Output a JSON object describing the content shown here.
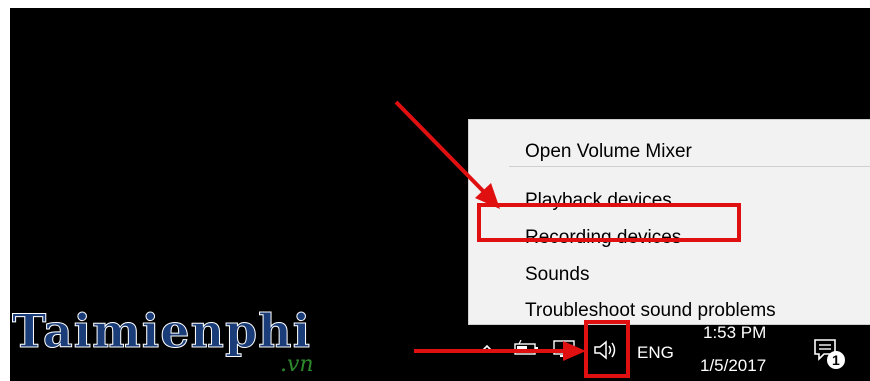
{
  "menu": {
    "items": [
      {
        "label": "Open Volume Mixer"
      },
      {
        "label": "Playback devices"
      },
      {
        "label": "Recording devices"
      },
      {
        "label": "Sounds"
      },
      {
        "label": "Troubleshoot sound problems"
      }
    ]
  },
  "taskbar": {
    "language": "ENG",
    "time": "1:53 PM",
    "date": "1/5/2017",
    "notification_count": "1",
    "icons": [
      "chevron-up-icon",
      "battery-icon",
      "network-icon",
      "speaker-icon",
      "action-center-icon"
    ]
  },
  "watermark": {
    "brand": "Taimienphi",
    "suffix": ".vn"
  },
  "colors": {
    "annotation_red": "#e01010",
    "menu_bg": "#f2f2f2",
    "taskbar_bg": "#000000"
  }
}
